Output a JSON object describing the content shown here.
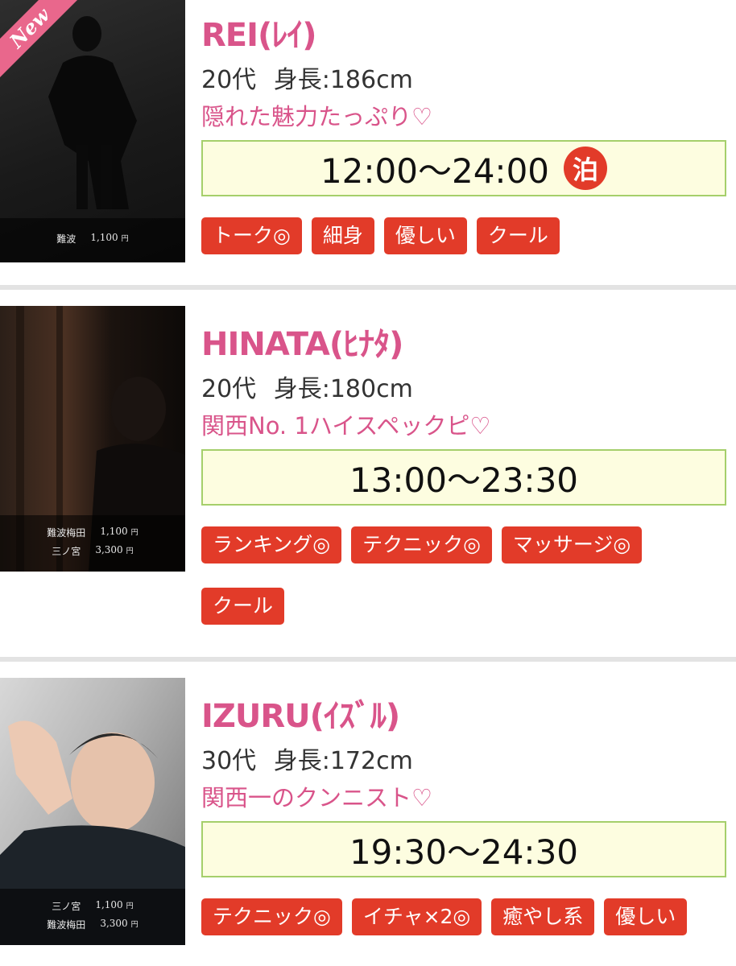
{
  "cast": [
    {
      "name": "REI(ﾚｲ)",
      "is_new": true,
      "new_label": "New",
      "age": "20代",
      "height_label": "身長:186cm",
      "catchphrase": "隠れた魅力たっぷり♡",
      "hours": "12:00〜24:00",
      "stay_badge": "泊",
      "prices": [
        {
          "area": "難波",
          "price": "1,100",
          "unit": "円"
        }
      ],
      "tags": [
        "トーク◎",
        "細身",
        "優しい",
        "クール"
      ]
    },
    {
      "name": "HINATA(ﾋﾅﾀ)",
      "age": "20代",
      "height_label": "身長:180cm",
      "catchphrase": "関西No. 1ハイスペックピ♡",
      "hours": "13:00〜23:30",
      "prices": [
        {
          "area": "難波梅田",
          "price": "1,100",
          "unit": "円"
        },
        {
          "area": "三ノ宮",
          "price": "3,300",
          "unit": "円"
        }
      ],
      "tags": [
        "ランキング◎",
        "テクニック◎",
        "マッサージ◎",
        "クール"
      ]
    },
    {
      "name": "IZURU(ｲｽﾞﾙ)",
      "age": "30代",
      "height_label": "身長:172cm",
      "catchphrase": "関西一のクンニスト♡",
      "hours": "19:30〜24:30",
      "prices": [
        {
          "area": "三ノ宮",
          "price": "1,100",
          "unit": "円"
        },
        {
          "area": "難波梅田",
          "price": "3,300",
          "unit": "円"
        }
      ],
      "tags": [
        "テクニック◎",
        "イチャ×2◎",
        "癒やし系",
        "優しい"
      ]
    }
  ],
  "colors": {
    "accent_pink": "#d9548a",
    "tag_red": "#e23b29",
    "time_box_bg": "#fdfde0",
    "time_box_border": "#a5cf6b"
  }
}
